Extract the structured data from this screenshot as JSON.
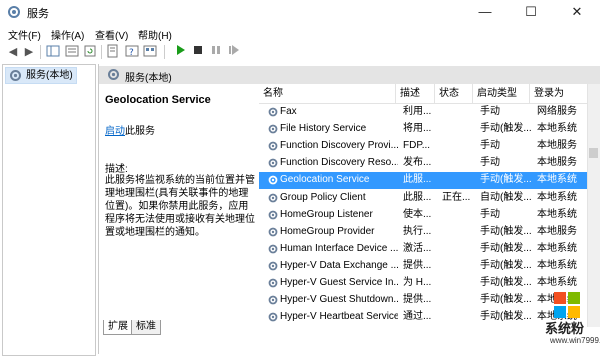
{
  "window": {
    "title": "服务",
    "minimize": "—",
    "maximize": "☐",
    "close": "✕"
  },
  "menu": [
    "文件(F)",
    "操作(A)",
    "查看(V)",
    "帮助(H)"
  ],
  "toolbar": [
    "back-arrow",
    "forward-arrow",
    "show-tree",
    "console-view",
    "export-list",
    "help",
    "properties",
    "start",
    "stop",
    "pause",
    "restart"
  ],
  "tree": {
    "root_label": "服务(本地)"
  },
  "pane": {
    "header_label": "服务(本地)"
  },
  "description": {
    "service_title": "Geolocation Service",
    "start_link": "启动",
    "start_suffix": "此服务",
    "label": "描述:",
    "text": "此服务将监视系统的当前位置并管理地理围栏(具有关联事件的地理位置)。如果你禁用此服务，应用程序将无法使用或接收有关地理位置或地理围栏的通知。"
  },
  "columns": [
    "名称",
    "描述",
    "状态",
    "启动类型",
    "登录为"
  ],
  "services": [
    {
      "name": "Fax",
      "desc": "利用...",
      "status": "",
      "startup": "手动",
      "logon": "网络服务"
    },
    {
      "name": "File History Service",
      "desc": "将用...",
      "status": "",
      "startup": "手动(触发...",
      "logon": "本地系统"
    },
    {
      "name": "Function Discovery Provi...",
      "desc": "FDP...",
      "status": "",
      "startup": "手动",
      "logon": "本地服务"
    },
    {
      "name": "Function Discovery Reso...",
      "desc": "发布...",
      "status": "",
      "startup": "手动",
      "logon": "本地服务"
    },
    {
      "name": "Geolocation Service",
      "desc": "此服...",
      "status": "",
      "startup": "手动(触发...",
      "logon": "本地系统"
    },
    {
      "name": "Group Policy Client",
      "desc": "此服...",
      "status": "正在...",
      "startup": "自动(触发...",
      "logon": "本地系统"
    },
    {
      "name": "HomeGroup Listener",
      "desc": "使本...",
      "status": "",
      "startup": "手动",
      "logon": "本地系统"
    },
    {
      "name": "HomeGroup Provider",
      "desc": "执行...",
      "status": "",
      "startup": "手动(触发...",
      "logon": "本地服务"
    },
    {
      "name": "Human Interface Device ...",
      "desc": "激活...",
      "status": "",
      "startup": "手动(触发...",
      "logon": "本地系统"
    },
    {
      "name": "Hyper-V Data Exchange ...",
      "desc": "提供...",
      "status": "",
      "startup": "手动(触发...",
      "logon": "本地系统"
    },
    {
      "name": "Hyper-V Guest Service In...",
      "desc": "为 H...",
      "status": "",
      "startup": "手动(触发...",
      "logon": "本地系统"
    },
    {
      "name": "Hyper-V Guest Shutdown...",
      "desc": "提供...",
      "status": "",
      "startup": "手动(触发...",
      "logon": "本地系统"
    },
    {
      "name": "Hyper-V Heartbeat Service",
      "desc": "通过...",
      "status": "",
      "startup": "手动(触发...",
      "logon": "本地系统"
    }
  ],
  "selected_index": 4,
  "tabs": [
    "扩展",
    "标准"
  ],
  "watermark": {
    "name": "系统粉",
    "url": "www.win7999.com"
  },
  "colors": {
    "selection": "#3399ff",
    "link": "#0064c8",
    "play_green": "#1a9c1a"
  }
}
